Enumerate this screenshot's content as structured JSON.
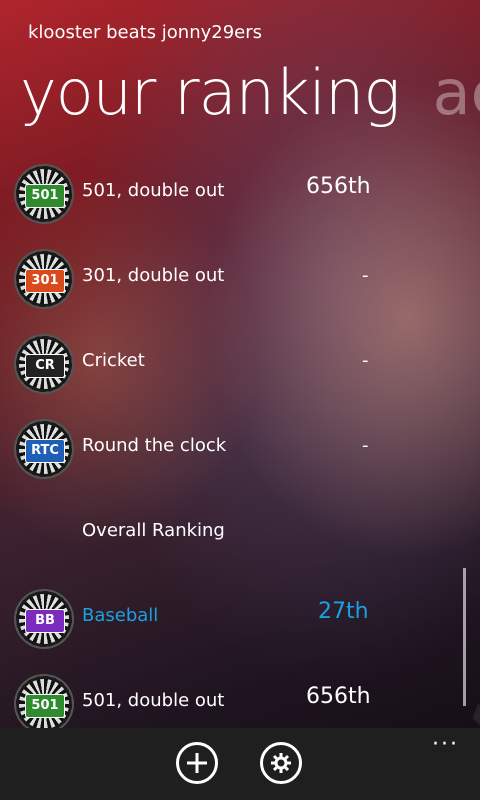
{
  "header": {
    "subtitle": "klooster beats jonny29ers"
  },
  "pivot": {
    "title": "your ranking",
    "next": "ac"
  },
  "rows": [
    {
      "icon": "501-dartboard-icon",
      "badge": "501",
      "badge_color": "#2e8b2e",
      "label": "501, double out",
      "value": "656th"
    },
    {
      "icon": "301-dartboard-icon",
      "badge": "301",
      "badge_color": "#d94a1e",
      "label": "301, double out",
      "value": "-"
    },
    {
      "icon": "cricket-dartboard-icon",
      "badge": "CR",
      "badge_color": "#222222",
      "label": "Cricket",
      "value": "-"
    },
    {
      "icon": "round-the-clock-dartboard-icon",
      "badge": "RTC",
      "badge_color": "#1f5fb5",
      "label": "Round the clock",
      "value": "-"
    },
    {
      "label": "Overall Ranking"
    },
    {
      "icon": "baseball-dartboard-icon",
      "badge": "BB",
      "badge_color": "#7b2cbf",
      "label": "Baseball",
      "value": "27th",
      "highlight": "#1ba1e2"
    },
    {
      "icon": "501-dartboard-icon",
      "badge": "501",
      "badge_color": "#2e8b2e",
      "label": "501, double out",
      "value": "656th"
    }
  ],
  "appbar": {
    "add_icon": "plus-circle-icon",
    "settings_icon": "gear-icon",
    "more": "···"
  },
  "colors": {
    "accent": "#1ba1e2",
    "appbar": "#1f1f1f"
  }
}
